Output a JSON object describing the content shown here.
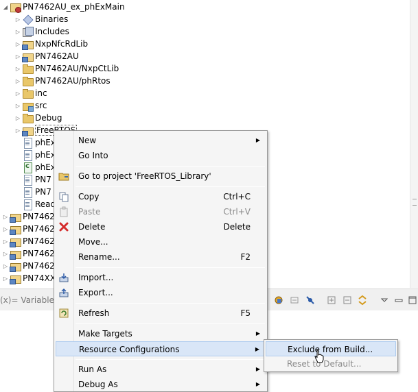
{
  "tree": {
    "root": "PN7462AU_ex_phExMain",
    "children": [
      "Binaries",
      "Includes",
      "NxpNfcRdLib",
      "PN7462AU",
      "PN7462AU/NxpCtLib",
      "PN7462AU/phRtos",
      "inc",
      "src",
      "Debug",
      "FreeRTOS",
      "phEx",
      "phEx",
      "phEx",
      "PN7",
      "PN7",
      "Read"
    ],
    "other_projects": [
      "PN7462",
      "PN7462",
      "PN7462",
      "PN7462",
      "PN7462",
      "PN74XX"
    ]
  },
  "bottom_panel": {
    "variables_tab": "(x)= Variables"
  },
  "context_menu": {
    "items": [
      {
        "label": "New",
        "submenu": true
      },
      {
        "label": "Go Into"
      },
      {
        "label": "Go to project 'FreeRTOS_Library'",
        "icon": "folder-icon"
      },
      {
        "label": "Copy",
        "shortcut": "Ctrl+C",
        "icon": "copy-icon"
      },
      {
        "label": "Paste",
        "shortcut": "Ctrl+V",
        "icon": "paste-icon",
        "disabled": true
      },
      {
        "label": "Delete",
        "shortcut": "Delete",
        "icon": "delete-icon"
      },
      {
        "label": "Move..."
      },
      {
        "label": "Rename...",
        "shortcut": "F2"
      },
      {
        "label": "Import...",
        "icon": "import-icon"
      },
      {
        "label": "Export...",
        "icon": "export-icon"
      },
      {
        "label": "Refresh",
        "shortcut": "F5",
        "icon": "refresh-icon"
      },
      {
        "label": "Make Targets",
        "submenu": true
      },
      {
        "label": "Resource Configurations",
        "submenu": true,
        "highlighted": true
      },
      {
        "label": "Run As",
        "submenu": true
      },
      {
        "label": "Debug As",
        "submenu": true
      }
    ]
  },
  "submenu": {
    "items": [
      {
        "label": "Exclude from Build...",
        "highlighted": true
      },
      {
        "label": "Reset to Default...",
        "disabled": true
      }
    ]
  },
  "colors": {
    "highlight": "#d9e6f7",
    "menu_bg": "#f5f5f5",
    "disabled_text": "#8a8a8a"
  }
}
